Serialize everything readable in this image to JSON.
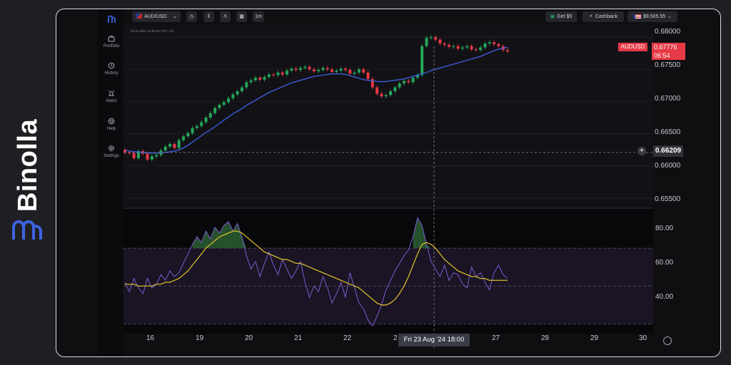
{
  "brand": {
    "name": "Binolla"
  },
  "header": {
    "symbol": "AUD/USD",
    "timeframe": "1m",
    "bonus_label": "Get $5",
    "cashback_label": "Cashback",
    "balance": "$9,505.55"
  },
  "chart_info": {
    "line": "23.11.2021 21:04:31 UTC +10"
  },
  "sidebar": {
    "items": [
      {
        "label": "Portfolio"
      },
      {
        "label": "History"
      },
      {
        "label": "Alerts"
      },
      {
        "label": "Help"
      },
      {
        "label": "Settings"
      }
    ]
  },
  "price_axis": {
    "ticks": [
      "0.68000",
      "0.67500",
      "0.67000",
      "0.66500",
      "0.66000",
      "0.65500"
    ]
  },
  "rsi_axis": {
    "ticks": [
      "80.00",
      "60.00",
      "40.00"
    ]
  },
  "date_axis": {
    "ticks": [
      "16",
      "19",
      "20",
      "21",
      "22",
      "2",
      "27",
      "28",
      "29",
      "30"
    ],
    "hover_label": "Fri 23 Aug '24   18:00"
  },
  "current": {
    "symbol": "AUDUSD",
    "price": "0.67776",
    "countdown": "06:54"
  },
  "crosshair": {
    "price": "0.66209"
  },
  "colors": {
    "up": "#26a65b",
    "down": "#e63946",
    "ma": "#3d5bd9",
    "rsi": "#7d5bd0",
    "rsi_ma": "#d4b82a",
    "badge": "#e63946"
  },
  "chart_data": {
    "type": "line",
    "price": {
      "ylim": [
        0.654,
        0.681
      ],
      "close": [
        0.6621,
        0.662,
        0.6612,
        0.6623,
        0.6619,
        0.661,
        0.6615,
        0.6617,
        0.6624,
        0.663,
        0.6634,
        0.6628,
        0.664,
        0.6646,
        0.6651,
        0.6659,
        0.6662,
        0.6668,
        0.6675,
        0.6682,
        0.669,
        0.6695,
        0.6699,
        0.6705,
        0.6711,
        0.6716,
        0.6722,
        0.673,
        0.6733,
        0.6737,
        0.6734,
        0.6738,
        0.6742,
        0.6741,
        0.6745,
        0.6742,
        0.6748,
        0.6751,
        0.6749,
        0.6752,
        0.6754,
        0.675,
        0.6747,
        0.6749,
        0.6752,
        0.675,
        0.6746,
        0.6748,
        0.6751,
        0.6749,
        0.6743,
        0.6745,
        0.675,
        0.6745,
        0.6735,
        0.6722,
        0.6712,
        0.6708,
        0.671,
        0.6716,
        0.6722,
        0.6728,
        0.6732,
        0.673,
        0.6737,
        0.6741,
        0.6786,
        0.6799,
        0.68,
        0.6796,
        0.679,
        0.6788,
        0.6785,
        0.6786,
        0.6782,
        0.6784,
        0.6786,
        0.6781,
        0.678,
        0.6784,
        0.679,
        0.6792,
        0.6789,
        0.6786,
        0.678,
        0.6778
      ],
      "ma": [
        0.6625,
        0.6623,
        0.6622,
        0.6622,
        0.6621,
        0.662,
        0.662,
        0.662,
        0.6621,
        0.6621,
        0.6622,
        0.6623,
        0.6625,
        0.6628,
        0.6632,
        0.6637,
        0.6642,
        0.6647,
        0.6652,
        0.6656,
        0.6661,
        0.6666,
        0.6671,
        0.6676,
        0.6681,
        0.6685,
        0.6689,
        0.6694,
        0.6698,
        0.6702,
        0.6706,
        0.671,
        0.6714,
        0.6717,
        0.672,
        0.6723,
        0.6726,
        0.6729,
        0.6731,
        0.6733,
        0.6735,
        0.6737,
        0.6739,
        0.674,
        0.6741,
        0.6742,
        0.6743,
        0.6743,
        0.6743,
        0.6742,
        0.674,
        0.6738,
        0.6736,
        0.6734,
        0.6733,
        0.6732,
        0.6731,
        0.6731,
        0.6731,
        0.6732,
        0.6733,
        0.6734,
        0.6735,
        0.6737,
        0.6739,
        0.6741,
        0.6743,
        0.6745,
        0.6748,
        0.675,
        0.6752,
        0.6754,
        0.6756,
        0.6758,
        0.676,
        0.6762,
        0.6764,
        0.6766,
        0.6768,
        0.677,
        0.6773,
        0.6776,
        0.6779,
        0.6781,
        0.6783,
        0.6784
      ]
    },
    "rsi": {
      "ylim": [
        26,
        90
      ],
      "rsi": [
        52,
        47,
        54,
        49,
        46,
        54,
        49,
        51,
        56,
        53,
        58,
        55,
        57,
        62,
        67,
        72,
        76,
        73,
        79,
        75,
        81,
        78,
        82,
        84,
        79,
        83,
        76,
        66,
        59,
        63,
        55,
        62,
        68,
        61,
        56,
        64,
        59,
        54,
        58,
        63,
        52,
        44,
        50,
        47,
        55,
        49,
        41,
        46,
        52,
        44,
        57,
        49,
        41,
        38,
        32,
        29,
        34,
        40,
        48,
        53,
        58,
        62,
        66,
        69,
        76,
        86,
        82,
        72,
        63,
        59,
        55,
        61,
        53,
        57,
        56,
        51,
        49,
        60,
        55,
        57,
        52,
        48,
        57,
        61,
        56,
        54
      ],
      "ma": [
        51,
        51,
        51,
        50,
        50,
        50,
        50,
        51,
        51,
        52,
        52,
        53,
        54,
        56,
        58,
        61,
        64,
        67,
        70,
        72,
        74,
        76,
        77,
        78,
        79,
        79,
        78,
        76,
        74,
        72,
        70,
        68,
        67,
        66,
        65,
        64,
        64,
        63,
        62,
        62,
        61,
        60,
        59,
        58,
        57,
        56,
        55,
        54,
        53,
        52,
        51,
        50,
        49,
        47,
        45,
        43,
        41,
        40,
        40,
        41,
        43,
        46,
        50,
        55,
        61,
        67,
        72,
        73,
        72,
        70,
        67,
        64,
        62,
        60,
        58,
        57,
        56,
        55,
        55,
        54,
        54,
        53,
        53,
        53,
        53,
        53
      ],
      "upper": 70,
      "middle": 50,
      "lower": 30
    }
  }
}
